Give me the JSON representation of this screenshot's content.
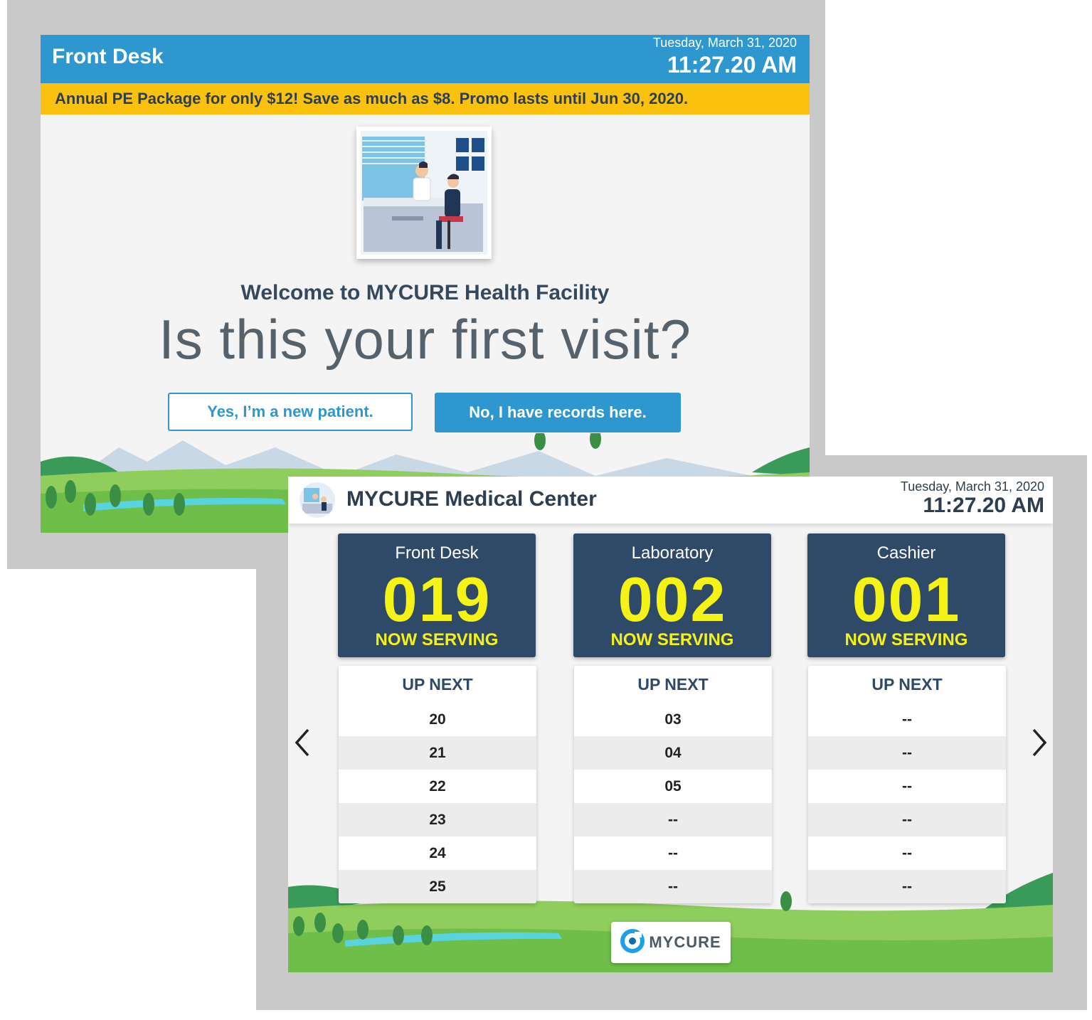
{
  "kiosk": {
    "title": "Front Desk",
    "date": "Tuesday, March 31, 2020",
    "time": "11:27.20 AM",
    "promo": "Annual PE Package for only $12! Save as much as $8. Promo lasts until Jun 30, 2020.",
    "welcome": "Welcome to MYCURE Health Facility",
    "question": "Is this your first visit?",
    "yes_label": "Yes, I’m a new patient.",
    "no_label": "No, I have records here."
  },
  "queue": {
    "title": "MYCURE Medical Center",
    "date": "Tuesday, March 31, 2020",
    "time": "11:27.20 AM",
    "now_serving_label": "NOW SERVING",
    "up_next_label": "UP NEXT",
    "counters": [
      {
        "name": "Front Desk",
        "number": "019",
        "up_next": [
          "20",
          "21",
          "22",
          "23",
          "24",
          "25"
        ]
      },
      {
        "name": "Laboratory",
        "number": "002",
        "up_next": [
          "03",
          "04",
          "05",
          "--",
          "--",
          "--"
        ]
      },
      {
        "name": "Cashier",
        "number": "001",
        "up_next": [
          "--",
          "--",
          "--",
          "--",
          "--",
          "--"
        ]
      }
    ],
    "brand": "MYCURE"
  },
  "colors": {
    "header_blue": "#2e97cf",
    "promo_yellow": "#fbc10f",
    "counter_navy": "#2f4a68",
    "serving_yellow": "#f5f316"
  },
  "icons": [
    "clinic-illustration",
    "chevron-left-icon",
    "chevron-right-icon",
    "mycure-logo-icon"
  ]
}
